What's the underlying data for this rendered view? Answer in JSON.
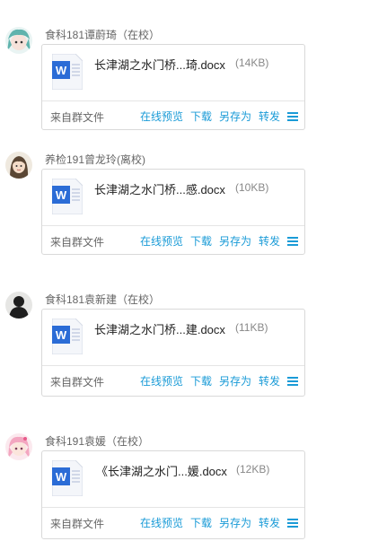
{
  "colors": {
    "link": "#1a9bd7",
    "word_blue": "#2b6cd6",
    "border": "#d9d9d9"
  },
  "messages": [
    {
      "sender": "食科181谭蔚琦（在校）",
      "avatar_icon": "avatar-anime-teal-icon",
      "file_name": "长津湖之水门桥...琦.docx",
      "file_size": "(14KB)",
      "file_icon": "word-doc-icon",
      "source": "来自群文件",
      "actions": {
        "preview": "在线预览",
        "download": "下载",
        "save_as": "另存为",
        "forward": "转发"
      }
    },
    {
      "sender": "养检191曾龙玲(离校)",
      "avatar_icon": "avatar-girl-illustration-icon",
      "file_name": "长津湖之水门桥...感.docx",
      "file_size": "(10KB)",
      "file_icon": "word-doc-icon",
      "source": "来自群文件",
      "actions": {
        "preview": "在线预览",
        "download": "下载",
        "save_as": "另存为",
        "forward": "转发"
      }
    },
    {
      "sender": "食科181袁新建（在校）",
      "avatar_icon": "avatar-dark-silhouette-icon",
      "file_name": "长津湖之水门桥...建.docx",
      "file_size": "(11KB)",
      "file_icon": "word-doc-icon",
      "source": "来自群文件",
      "actions": {
        "preview": "在线预览",
        "download": "下载",
        "save_as": "另存为",
        "forward": "转发"
      }
    },
    {
      "sender": "食科191袁媛（在校）",
      "avatar_icon": "avatar-anime-pink-icon",
      "file_name": "《长津湖之水门...媛.docx",
      "file_size": "(12KB)",
      "file_icon": "word-doc-icon",
      "source": "来自群文件",
      "actions": {
        "preview": "在线预览",
        "download": "下载",
        "save_as": "另存为",
        "forward": "转发"
      }
    }
  ]
}
